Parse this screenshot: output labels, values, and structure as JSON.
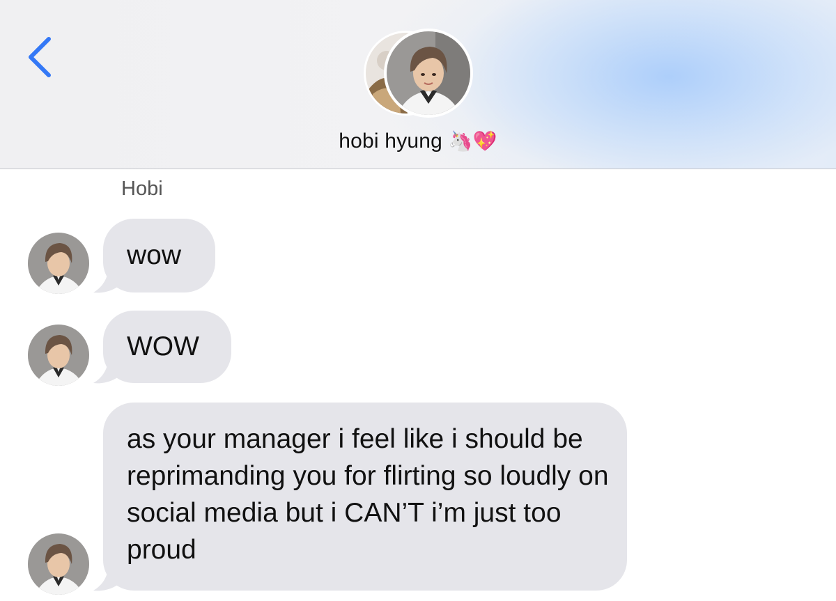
{
  "header": {
    "back_icon": "chevron-left-icon",
    "accent_color": "#3478f6",
    "contact_name": "hobi hyung",
    "contact_emojis": [
      "🦄",
      "💖"
    ]
  },
  "conversation": {
    "sender_label": "Hobi",
    "bubble_color": "#e5e5ea",
    "messages": [
      {
        "text": "wow"
      },
      {
        "text": "WOW"
      },
      {
        "text": "as your manager i feel like i should be reprimanding you for flirting so loudly on social media but i CAN’T i’m just too proud"
      }
    ]
  }
}
